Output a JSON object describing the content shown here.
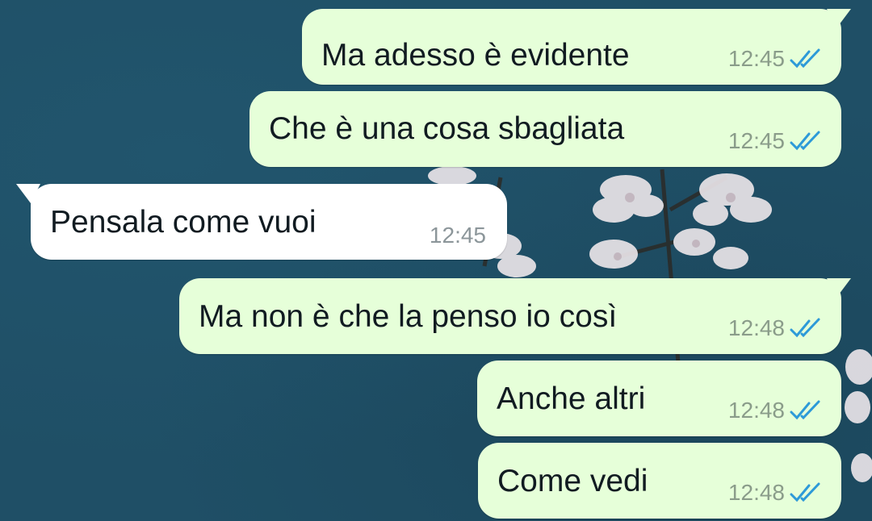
{
  "chat": {
    "messages": [
      {
        "direction": "out",
        "text": "Ma adesso è evidente",
        "time": "12:45",
        "status_icon": "double-check-read-icon"
      },
      {
        "direction": "out",
        "text": "Che è una cosa sbagliata",
        "time": "12:45",
        "status_icon": "double-check-read-icon"
      },
      {
        "direction": "in",
        "text": "Pensala come vuoi",
        "time": "12:45"
      },
      {
        "direction": "out",
        "text": "Ma non è che la penso io così",
        "time": "12:48",
        "status_icon": "double-check-read-icon"
      },
      {
        "direction": "out",
        "text": "Anche altri",
        "time": "12:48",
        "status_icon": "double-check-read-icon"
      },
      {
        "direction": "out",
        "text": "Come vedi",
        "time": "12:48",
        "status_icon": "double-check-read-icon"
      }
    ]
  },
  "colors": {
    "wallpaper": "#1f4f66",
    "outgoing_bubble": "#e6ffd9",
    "incoming_bubble": "#ffffff",
    "read_tick": "#2d9ad8"
  }
}
